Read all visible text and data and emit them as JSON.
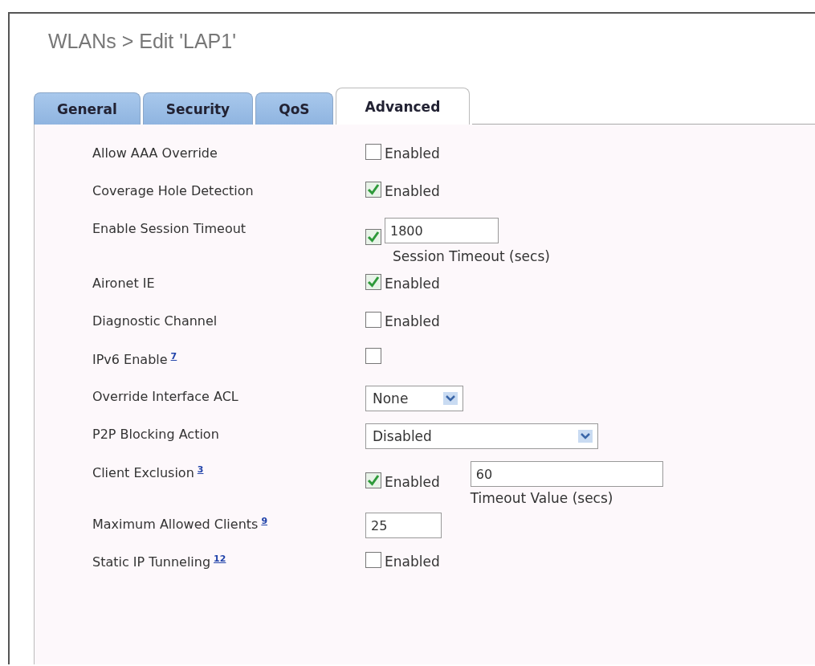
{
  "title": "WLANs > Edit  'LAP1'",
  "tabs": [
    {
      "label": "General",
      "selected": false
    },
    {
      "label": "Security",
      "selected": false
    },
    {
      "label": "QoS",
      "selected": false
    },
    {
      "label": "Advanced",
      "selected": true
    }
  ],
  "rows": [
    {
      "kind": "checkbox",
      "label": "Allow AAA Override",
      "checked": false,
      "option": "Enabled"
    },
    {
      "kind": "checkbox",
      "label": "Coverage Hole Detection",
      "checked": true,
      "option": "Enabled"
    },
    {
      "kind": "checkbox_field",
      "label": "Enable Session Timeout",
      "checked": true,
      "value": "1800",
      "hint": "Session Timeout (secs)"
    },
    {
      "kind": "checkbox",
      "label": "Aironet IE",
      "checked": true,
      "option": "Enabled"
    },
    {
      "kind": "checkbox",
      "label": "Diagnostic Channel",
      "checked": false,
      "option": "Enabled"
    },
    {
      "kind": "checkbox",
      "label": "IPv6 Enable",
      "note": "7",
      "checked": false
    },
    {
      "kind": "dropdown",
      "label": "Override Interface ACL",
      "value": "None"
    },
    {
      "kind": "wide_dropdown",
      "label": "P2P Blocking Action",
      "value": "Disabled"
    },
    {
      "kind": "checkbox_side_field",
      "label": "Client Exclusion",
      "note": "3",
      "checked": true,
      "option": "Enabled",
      "value": "60",
      "hint": "Timeout Value (secs)"
    },
    {
      "kind": "field",
      "label": "Maximum Allowed Clients",
      "note": "9",
      "value": "25"
    },
    {
      "kind": "checkbox",
      "label": "Static IP Tunneling",
      "note": "12",
      "checked": false,
      "option": "Enabled"
    }
  ]
}
